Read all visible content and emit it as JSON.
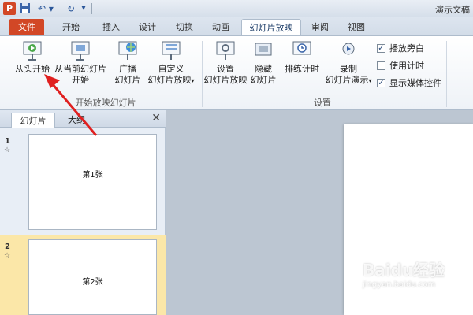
{
  "titlebar": {
    "app_letter": "P",
    "doc_title": "演示文稿"
  },
  "tabs": [
    {
      "label": "文件"
    },
    {
      "label": "开始"
    },
    {
      "label": "插入"
    },
    {
      "label": "设计"
    },
    {
      "label": "切换"
    },
    {
      "label": "动画"
    },
    {
      "label": "幻灯片放映"
    },
    {
      "label": "审阅"
    },
    {
      "label": "视图"
    }
  ],
  "ribbon": {
    "start_group": {
      "label": "开始放映幻灯片",
      "from_beginning": "从头开始",
      "from_current_line1": "从当前幻灯片",
      "from_current_line2": "开始",
      "broadcast_line1": "广播",
      "broadcast_line2": "幻灯片",
      "custom_line1": "自定义",
      "custom_line2": "幻灯片放映"
    },
    "setup_group": {
      "label": "设置",
      "setup_line1": "设置",
      "setup_line2": "幻灯片放映",
      "hide_line1": "隐藏",
      "hide_line2": "幻灯片",
      "rehearse": "排练计时",
      "record_line1": "录制",
      "record_line2": "幻灯片演示",
      "chk_narration": "播放旁白",
      "chk_timing": "使用计时",
      "chk_media": "显示媒体控件"
    }
  },
  "pane": {
    "tab_slides": "幻灯片",
    "tab_outline": "大纲",
    "close": "✕",
    "slides": [
      {
        "num": "1",
        "star": "☆",
        "text": "第1张"
      },
      {
        "num": "2",
        "star": "☆",
        "text": "第2张"
      }
    ]
  },
  "watermark": {
    "brand": "Baidu经验",
    "url": "jingyan.baidu.com"
  },
  "colors": {
    "file_tab": "#d24726",
    "accent": "#2b579a",
    "arrow": "#e02020",
    "selected_thumb": "#fbe7a8"
  }
}
